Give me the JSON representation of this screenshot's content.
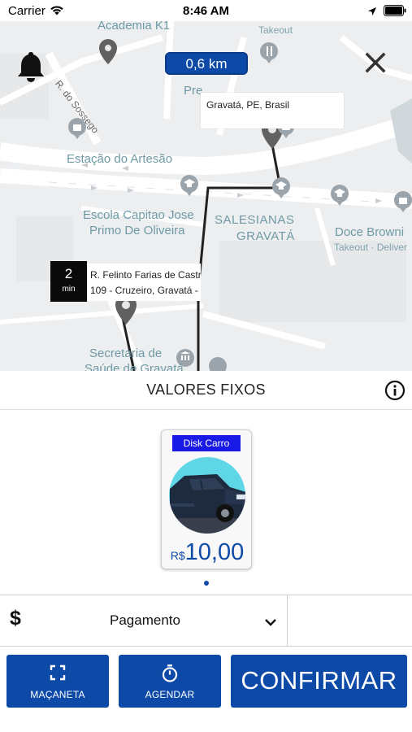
{
  "status_bar": {
    "carrier": "Carrier",
    "time": "8:46 AM",
    "icons": [
      "wifi-icon",
      "location-arrow-icon",
      "battery-icon"
    ]
  },
  "map": {
    "distance": "0,6 km",
    "destination": "Gravatá, PE, Brasil",
    "eta_value": "2",
    "eta_unit": "min",
    "origin_line1": "R. Felinto Farias de Castro,",
    "origin_line2": "109 - Cruzeiro, Gravatá -",
    "labels": {
      "academia": "Academia K1",
      "takeout_top": "Takeout",
      "street_sossego": "R. do Sossego",
      "pre": "Pre",
      "estacao": "Estação do Artesão",
      "escola_1": "Escola Capitao Jose",
      "escola_2": "Primo De Oliveira",
      "salesianas_1": "SALESIANAS",
      "salesianas_2": "GRAVATÁ",
      "doce_1": "Doce Browni",
      "doce_2": "Takeout · Deliver",
      "secretaria_1": "Secretaria de",
      "secretaria_2": "Saúde de Gravatá"
    },
    "icons": [
      "bell-icon",
      "close-icon",
      "map-pin-icon",
      "school-icon",
      "shopping-bag-icon",
      "restaurant-icon",
      "bank-icon"
    ]
  },
  "section": {
    "title": "VALORES FIXOS"
  },
  "card": {
    "tag": "Disk Carro",
    "currency": "R$",
    "price": "10,00"
  },
  "payment": {
    "label": "Pagamento"
  },
  "buttons": {
    "macaneta": "MAÇANETA",
    "agendar": "AGENDAR",
    "confirmar": "CONFIRMAR"
  },
  "colors": {
    "primary": "#0d4aa8",
    "tag_blue": "#1a1ae6",
    "map_bg": "#eceef0",
    "map_label": "#6f9aa5"
  }
}
